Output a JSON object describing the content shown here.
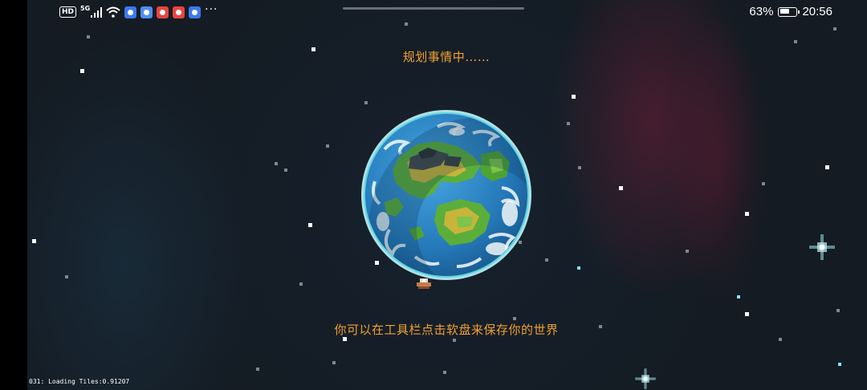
{
  "status_bar": {
    "hd_label": "HD",
    "network_label": "5G",
    "more_label": "···",
    "battery_percent": "63%",
    "battery_level": 0.63,
    "time": "20:56"
  },
  "game": {
    "planning_text": "规划事情中……",
    "save_hint": "你可以在工具栏点击软盘来保存你的世界",
    "debug_text": "031: Loading Tiles:0.91207"
  },
  "colors": {
    "hint_orange": "#f0a030",
    "space_background": "#141b23",
    "ocean": "#2e88c8",
    "land_green": "#5cae3a",
    "land_yellow": "#c8b43a",
    "atmosphere": "#a8f0f4"
  },
  "icons": [
    "hd-icon",
    "signal-icon",
    "wifi-icon",
    "baidu-app-icon",
    "browser-app-icon",
    "red-app-icon",
    "red-app-icon-2",
    "baidu-app-icon-2",
    "battery-icon"
  ]
}
